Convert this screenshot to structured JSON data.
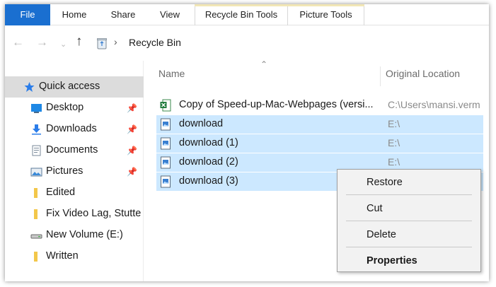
{
  "ribbon": {
    "tabs": [
      {
        "label": "File"
      },
      {
        "label": "Home"
      },
      {
        "label": "Share"
      },
      {
        "label": "View"
      },
      {
        "label": "Recycle Bin Tools"
      },
      {
        "label": "Picture Tools"
      }
    ]
  },
  "address": {
    "breadcrumb": "Recycle Bin"
  },
  "nav": {
    "items": [
      {
        "label": "Quick access",
        "icon": "star-icon",
        "pinned": false
      },
      {
        "label": "Desktop",
        "icon": "desktop-icon",
        "pinned": true
      },
      {
        "label": "Downloads",
        "icon": "download-arrow-icon",
        "pinned": true
      },
      {
        "label": "Documents",
        "icon": "document-icon",
        "pinned": true
      },
      {
        "label": "Pictures",
        "icon": "pictures-icon",
        "pinned": true
      },
      {
        "label": "Edited",
        "icon": "folder-icon",
        "pinned": false
      },
      {
        "label": "Fix Video Lag, Stutte",
        "icon": "folder-icon",
        "pinned": false
      },
      {
        "label": "New Volume (E:)",
        "icon": "drive-icon",
        "pinned": false
      },
      {
        "label": "Written",
        "icon": "folder-icon",
        "pinned": false
      }
    ]
  },
  "list": {
    "columns": {
      "name": "Name",
      "location": "Original Location"
    },
    "rows": [
      {
        "name": "Copy of Speed-up-Mac-Webpages (versi...",
        "location": "C:\\Users\\mansi.verm",
        "icon": "excel-file-icon",
        "selected": false
      },
      {
        "name": "download",
        "location": "E:\\",
        "icon": "image-file-icon",
        "selected": true
      },
      {
        "name": "download (1)",
        "location": "E:\\",
        "icon": "image-file-icon",
        "selected": true
      },
      {
        "name": "download (2)",
        "location": "E:\\",
        "icon": "image-file-icon",
        "selected": true
      },
      {
        "name": "download (3)",
        "location": "",
        "icon": "image-file-icon",
        "selected": true
      }
    ]
  },
  "context_menu": {
    "items": [
      {
        "label": "Restore"
      },
      {
        "label": "Cut"
      },
      {
        "label": "Delete"
      },
      {
        "label": "Properties"
      }
    ]
  },
  "colors": {
    "file_tab": "#1a6fd0",
    "selection": "#cce8ff",
    "quick_access_highlight": "#dcdcdc",
    "recycle_bin_tools_accent": "#e8d27a",
    "picture_tools_accent": "#e8d27a"
  }
}
